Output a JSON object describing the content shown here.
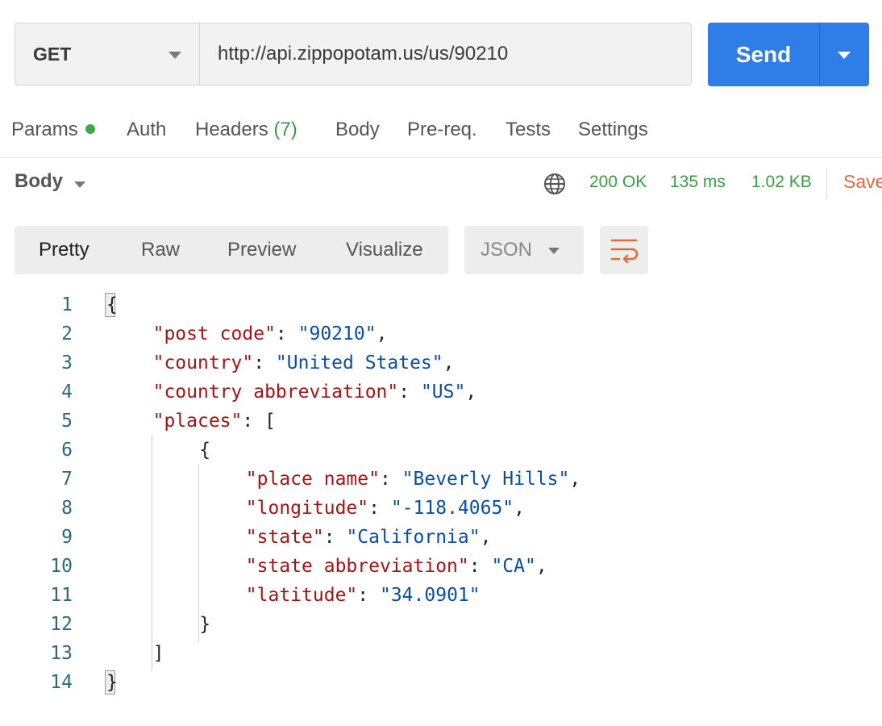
{
  "request": {
    "method": "GET",
    "url": "http://api.zippopotam.us/us/90210",
    "send_label": "Send"
  },
  "tabs": [
    {
      "label": "Params"
    },
    {
      "label": "Auth"
    },
    {
      "label": "Headers",
      "count": "(7)"
    },
    {
      "label": "Body"
    },
    {
      "label": "Pre-req."
    },
    {
      "label": "Tests"
    },
    {
      "label": "Settings"
    }
  ],
  "response": {
    "section_label": "Body",
    "status": "200 OK",
    "time": "135 ms",
    "size": "1.02 KB",
    "save_label": "Save"
  },
  "view": {
    "tabs": [
      "Pretty",
      "Raw",
      "Preview",
      "Visualize"
    ],
    "active": "Pretty",
    "format": "JSON"
  },
  "colors": {
    "accent": "#2f7ee8",
    "status_green": "#3a9c43",
    "save_orange": "#e36a3a",
    "json_key": "#a31515",
    "json_string": "#0a4ea3"
  },
  "code": {
    "line_numbers": [
      "1",
      "2",
      "3",
      "4",
      "5",
      "6",
      "7",
      "8",
      "9",
      "10",
      "11",
      "12",
      "13",
      "14"
    ],
    "lines": [
      {
        "indent": 0,
        "parts": [
          {
            "t": "p",
            "v": "{"
          }
        ]
      },
      {
        "indent": 1,
        "parts": [
          {
            "t": "k",
            "v": "\"post code\""
          },
          {
            "t": "p",
            "v": ": "
          },
          {
            "t": "s",
            "v": "\"90210\""
          },
          {
            "t": "p",
            "v": ","
          }
        ]
      },
      {
        "indent": 1,
        "parts": [
          {
            "t": "k",
            "v": "\"country\""
          },
          {
            "t": "p",
            "v": ": "
          },
          {
            "t": "s",
            "v": "\"United States\""
          },
          {
            "t": "p",
            "v": ","
          }
        ]
      },
      {
        "indent": 1,
        "parts": [
          {
            "t": "k",
            "v": "\"country abbreviation\""
          },
          {
            "t": "p",
            "v": ": "
          },
          {
            "t": "s",
            "v": "\"US\""
          },
          {
            "t": "p",
            "v": ","
          }
        ]
      },
      {
        "indent": 1,
        "parts": [
          {
            "t": "k",
            "v": "\"places\""
          },
          {
            "t": "p",
            "v": ": ["
          }
        ]
      },
      {
        "indent": 2,
        "parts": [
          {
            "t": "p",
            "v": "{"
          }
        ]
      },
      {
        "indent": 3,
        "parts": [
          {
            "t": "k",
            "v": "\"place name\""
          },
          {
            "t": "p",
            "v": ": "
          },
          {
            "t": "s",
            "v": "\"Beverly Hills\""
          },
          {
            "t": "p",
            "v": ","
          }
        ]
      },
      {
        "indent": 3,
        "parts": [
          {
            "t": "k",
            "v": "\"longitude\""
          },
          {
            "t": "p",
            "v": ": "
          },
          {
            "t": "s",
            "v": "\"-118.4065\""
          },
          {
            "t": "p",
            "v": ","
          }
        ]
      },
      {
        "indent": 3,
        "parts": [
          {
            "t": "k",
            "v": "\"state\""
          },
          {
            "t": "p",
            "v": ": "
          },
          {
            "t": "s",
            "v": "\"California\""
          },
          {
            "t": "p",
            "v": ","
          }
        ]
      },
      {
        "indent": 3,
        "parts": [
          {
            "t": "k",
            "v": "\"state abbreviation\""
          },
          {
            "t": "p",
            "v": ": "
          },
          {
            "t": "s",
            "v": "\"CA\""
          },
          {
            "t": "p",
            "v": ","
          }
        ]
      },
      {
        "indent": 3,
        "parts": [
          {
            "t": "k",
            "v": "\"latitude\""
          },
          {
            "t": "p",
            "v": ": "
          },
          {
            "t": "s",
            "v": "\"34.0901\""
          }
        ]
      },
      {
        "indent": 2,
        "parts": [
          {
            "t": "p",
            "v": "}"
          }
        ]
      },
      {
        "indent": 1,
        "parts": [
          {
            "t": "p",
            "v": "]"
          }
        ]
      },
      {
        "indent": 0,
        "parts": [
          {
            "t": "p",
            "v": "}"
          }
        ]
      }
    ]
  }
}
